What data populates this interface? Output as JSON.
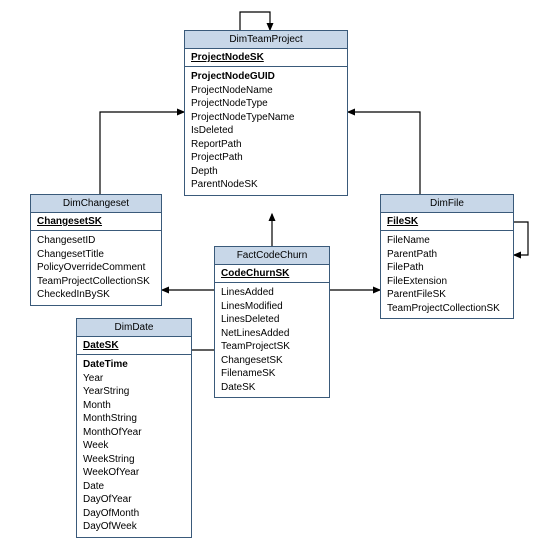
{
  "entities": {
    "dimTeamProject": {
      "title": "DimTeamProject",
      "pk": "ProjectNodeSK",
      "fields": [
        "ProjectNodeGUID",
        "ProjectNodeName",
        "ProjectNodeType",
        "ProjectNodeTypeName",
        "IsDeleted",
        "ReportPath",
        "ProjectPath",
        "Depth",
        "ParentNodeSK"
      ],
      "boldFields": [
        "ProjectNodeGUID"
      ]
    },
    "dimChangeset": {
      "title": "DimChangeset",
      "pk": "ChangesetSK",
      "fields": [
        "ChangesetID",
        "ChangesetTitle",
        "PolicyOverrideComment",
        "TeamProjectCollectionSK",
        "CheckedInBySK"
      ],
      "boldFields": []
    },
    "dimFile": {
      "title": "DimFile",
      "pk": "FileSK",
      "fields": [
        "FileName",
        "ParentPath",
        "FilePath",
        "FileExtension",
        "ParentFileSK",
        "TeamProjectCollectionSK"
      ],
      "boldFields": []
    },
    "factCodeChurn": {
      "title": "FactCodeChurn",
      "pk": "CodeChurnSK",
      "fields": [
        "LinesAdded",
        "LinesModified",
        "LinesDeleted",
        "NetLinesAdded",
        "TeamProjectSK",
        "ChangesetSK",
        "FilenameSK",
        "DateSK"
      ],
      "boldFields": []
    },
    "dimDate": {
      "title": "DimDate",
      "pk": "DateSK",
      "fields": [
        "DateTime",
        "Year",
        "YearString",
        "Month",
        "MonthString",
        "MonthOfYear",
        "Week",
        "WeekString",
        "WeekOfYear",
        "Date",
        "DayOfYear",
        "DayOfMonth",
        "DayOfWeek"
      ],
      "boldFields": [
        "DateTime"
      ]
    }
  }
}
